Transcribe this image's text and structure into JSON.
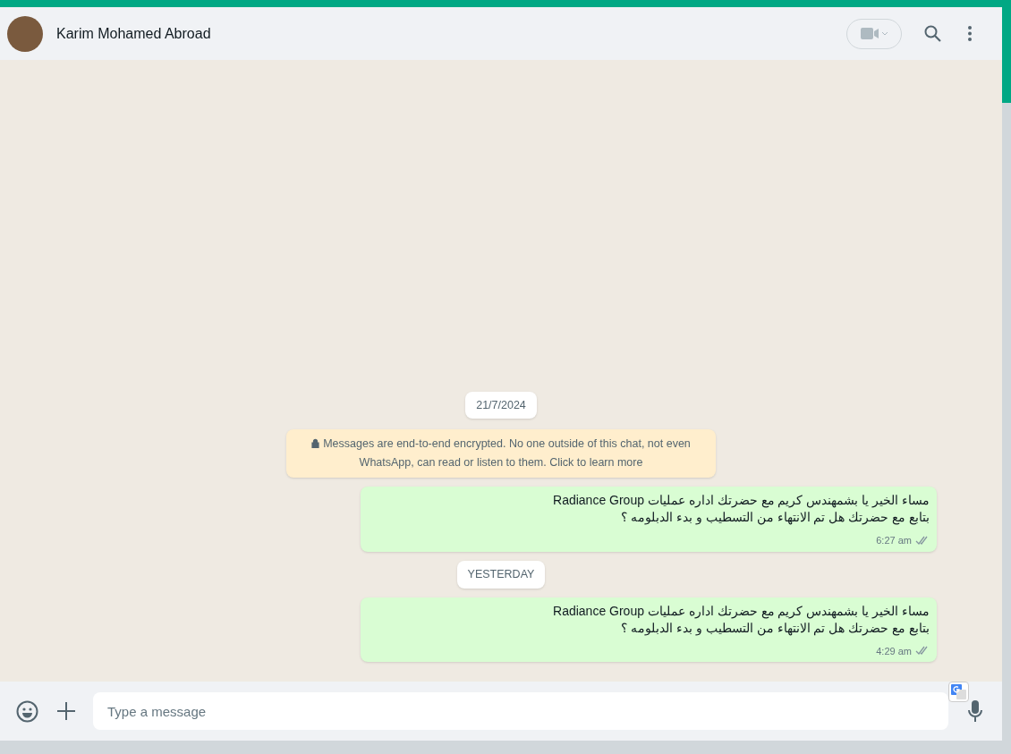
{
  "header": {
    "contact_name": "Karim Mohamed Abroad"
  },
  "chat": {
    "items": [
      {
        "kind": "date",
        "text": "21/7/2024"
      },
      {
        "kind": "notice",
        "text": "Messages are end-to-end encrypted. No one outside of this chat, not even WhatsApp, can read or listen to them. Click to learn more"
      },
      {
        "kind": "message",
        "lines": [
          "مساء الخير يا بشمهندس كريم مع  حضرتك اداره عمليات Radiance Group",
          "بتابع مع حضرتك هل تم الانتهاء من التسطيب و بدء الدبلومه ؟"
        ],
        "time": "6:27 am"
      },
      {
        "kind": "date",
        "text": "YESTERDAY"
      },
      {
        "kind": "message",
        "lines": [
          "مساء الخير يا بشمهندس كريم مع  حضرتك اداره عمليات Radiance Group",
          "بتابع مع حضرتك هل تم الانتهاء من التسطيب و بدء الدبلومه ؟"
        ],
        "time": "4:29 am"
      }
    ]
  },
  "composer": {
    "placeholder": "Type a message"
  }
}
